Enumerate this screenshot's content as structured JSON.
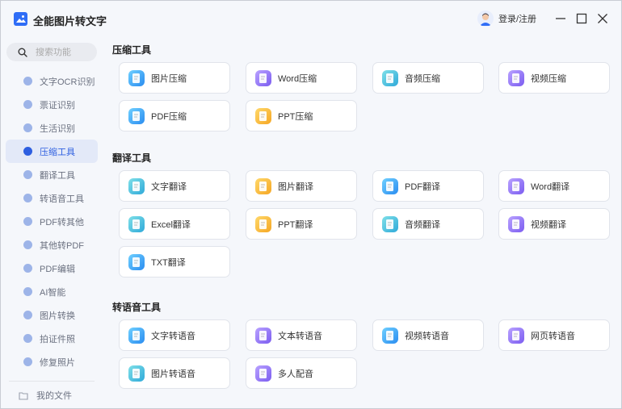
{
  "app": {
    "title": "全能图片转文字"
  },
  "header": {
    "login_label": "登录/注册"
  },
  "sidebar": {
    "search_placeholder": "搜索功能",
    "items": [
      {
        "label": "文字OCR识别",
        "icon": "ocr-icon",
        "color": "#9db4e8",
        "active": false
      },
      {
        "label": "票证识别",
        "icon": "ticket-icon",
        "color": "#9db4e8",
        "active": false
      },
      {
        "label": "生活识别",
        "icon": "pen-icon",
        "color": "#9db4e8",
        "active": false
      },
      {
        "label": "压缩工具",
        "icon": "compress-icon",
        "color": "#2e5fe0",
        "active": true
      },
      {
        "label": "翻译工具",
        "icon": "translate-icon",
        "color": "#9db4e8",
        "active": false
      },
      {
        "label": "转语音工具",
        "icon": "voice-icon",
        "color": "#9db4e8",
        "active": false
      },
      {
        "label": "PDF转其他",
        "icon": "pdf-convert-icon",
        "color": "#9db4e8",
        "active": false
      },
      {
        "label": "其他转PDF",
        "icon": "to-pdf-icon",
        "color": "#9db4e8",
        "active": false
      },
      {
        "label": "PDF编辑",
        "icon": "pdf-edit-icon",
        "color": "#9db4e8",
        "active": false
      },
      {
        "label": "AI智能",
        "icon": "ai-icon",
        "color": "#9db4e8",
        "active": false
      },
      {
        "label": "图片转换",
        "icon": "image-convert-icon",
        "color": "#9db4e8",
        "active": false
      },
      {
        "label": "拍证件照",
        "icon": "camera-icon",
        "color": "#9db4e8",
        "active": false
      },
      {
        "label": "修复照片",
        "icon": "repair-icon",
        "color": "#9db4e8",
        "active": false
      }
    ],
    "my_files_label": "我的文件"
  },
  "sections": [
    {
      "title": "压缩工具",
      "tools": [
        {
          "label": "图片压缩",
          "color": "blue"
        },
        {
          "label": "Word压缩",
          "color": "purple"
        },
        {
          "label": "音频压缩",
          "color": "teal"
        },
        {
          "label": "视频压缩",
          "color": "purple"
        },
        {
          "label": "PDF压缩",
          "color": "blue"
        },
        {
          "label": "PPT压缩",
          "color": "orange"
        }
      ]
    },
    {
      "title": "翻译工具",
      "tools": [
        {
          "label": "文字翻译",
          "color": "teal"
        },
        {
          "label": "图片翻译",
          "color": "orange"
        },
        {
          "label": "PDF翻译",
          "color": "blue"
        },
        {
          "label": "Word翻译",
          "color": "purple"
        },
        {
          "label": "Excel翻译",
          "color": "teal"
        },
        {
          "label": "PPT翻译",
          "color": "orange"
        },
        {
          "label": "音频翻译",
          "color": "teal"
        },
        {
          "label": "视频翻译",
          "color": "purple"
        },
        {
          "label": "TXT翻译",
          "color": "blue"
        }
      ]
    },
    {
      "title": "转语音工具",
      "tools": [
        {
          "label": "文字转语音",
          "color": "blue"
        },
        {
          "label": "文本转语音",
          "color": "purple"
        },
        {
          "label": "视频转语音",
          "color": "blue"
        },
        {
          "label": "网页转语音",
          "color": "purple"
        },
        {
          "label": "图片转语音",
          "color": "teal"
        },
        {
          "label": "多人配音",
          "color": "purple"
        }
      ]
    }
  ]
}
